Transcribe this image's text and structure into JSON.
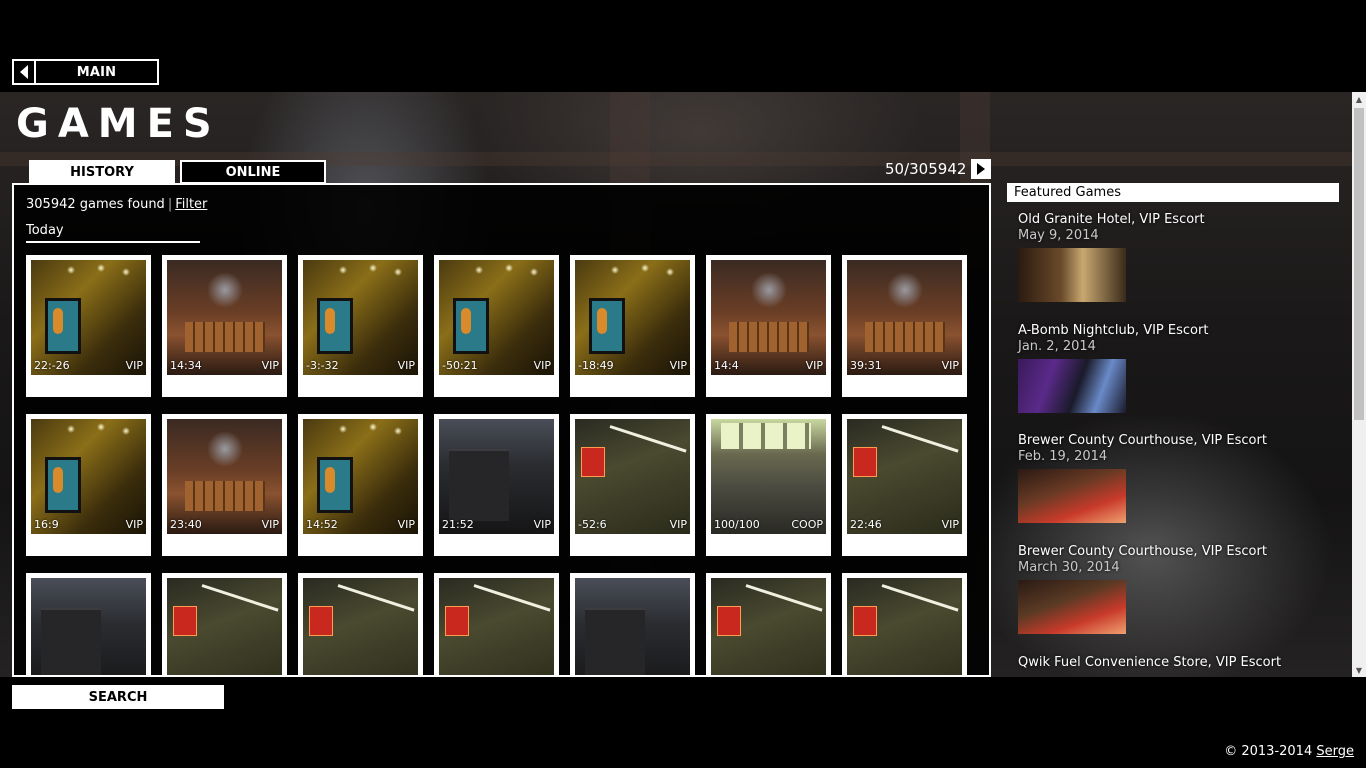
{
  "nav": {
    "main_label": "MAIN"
  },
  "page_title": "GAMES",
  "tabs": [
    {
      "label": "HISTORY",
      "active": true
    },
    {
      "label": "ONLINE",
      "active": false
    }
  ],
  "pager": {
    "text": "50/305942"
  },
  "panel": {
    "found_text": "305942 games found",
    "separator": "|",
    "filter_label": "Filter",
    "section_label": "Today"
  },
  "games": [
    {
      "time": "22:-26",
      "mode": "VIP",
      "thumb": "hotel"
    },
    {
      "time": "14:34",
      "mode": "VIP",
      "thumb": "club"
    },
    {
      "time": "-3:-32",
      "mode": "VIP",
      "thumb": "hotel"
    },
    {
      "time": "-50:21",
      "mode": "VIP",
      "thumb": "hotel"
    },
    {
      "time": "-18:49",
      "mode": "VIP",
      "thumb": "hotel"
    },
    {
      "time": "14:4",
      "mode": "VIP",
      "thumb": "club"
    },
    {
      "time": "39:31",
      "mode": "VIP",
      "thumb": "club"
    },
    {
      "time": "16:9",
      "mode": "VIP",
      "thumb": "hotel"
    },
    {
      "time": "23:40",
      "mode": "VIP",
      "thumb": "club"
    },
    {
      "time": "14:52",
      "mode": "VIP",
      "thumb": "hotel"
    },
    {
      "time": "21:52",
      "mode": "VIP",
      "thumb": "gray"
    },
    {
      "time": "-52:6",
      "mode": "VIP",
      "thumb": "street"
    },
    {
      "time": "100/100",
      "mode": "COOP",
      "thumb": "coop"
    },
    {
      "time": "22:46",
      "mode": "VIP",
      "thumb": "street"
    },
    {
      "time": "",
      "mode": "",
      "thumb": "gray"
    },
    {
      "time": "",
      "mode": "",
      "thumb": "street"
    },
    {
      "time": "",
      "mode": "",
      "thumb": "street"
    },
    {
      "time": "",
      "mode": "",
      "thumb": "street"
    },
    {
      "time": "",
      "mode": "",
      "thumb": "gray"
    },
    {
      "time": "",
      "mode": "",
      "thumb": "street"
    },
    {
      "time": "",
      "mode": "",
      "thumb": "street"
    }
  ],
  "featured": {
    "heading": "Featured Games",
    "items": [
      {
        "title": "Old Granite Hotel, VIP Escort",
        "date": "May 9, 2014"
      },
      {
        "title": "A-Bomb Nightclub, VIP Escort",
        "date": "Jan. 2, 2014"
      },
      {
        "title": "Brewer County Courthouse, VIP Escort",
        "date": "Feb. 19, 2014"
      },
      {
        "title": "Brewer County Courthouse, VIP Escort",
        "date": "March 30, 2014"
      },
      {
        "title": "Qwik Fuel Convenience Store, VIP Escort",
        "date": ""
      }
    ]
  },
  "search_label": "SEARCH",
  "footer": {
    "copyright": "© 2013-2014",
    "author": "Serge"
  }
}
